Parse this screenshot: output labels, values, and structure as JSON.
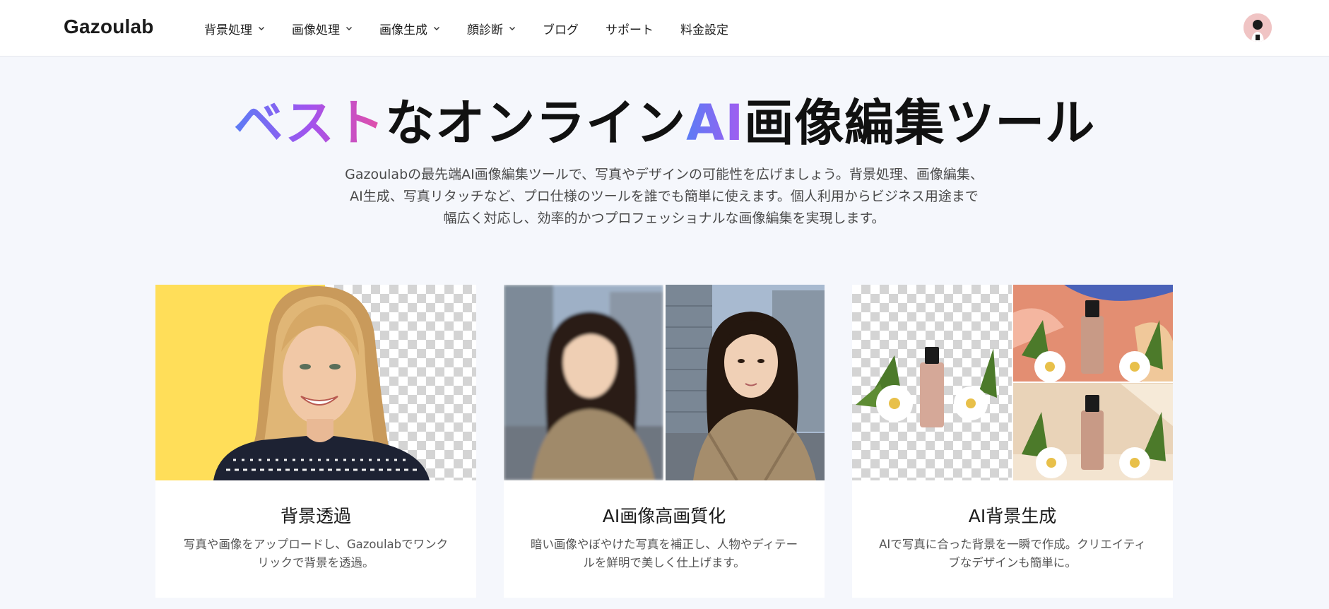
{
  "header": {
    "logo": "Gazoulab",
    "nav": [
      {
        "label": "背景処理",
        "dropdown": true
      },
      {
        "label": "画像処理",
        "dropdown": true
      },
      {
        "label": "画像生成",
        "dropdown": true
      },
      {
        "label": "顔診断",
        "dropdown": true
      },
      {
        "label": "ブログ",
        "dropdown": false
      },
      {
        "label": "サポート",
        "dropdown": false
      },
      {
        "label": "料金設定",
        "dropdown": false
      }
    ]
  },
  "hero": {
    "title_grad1": "ベスト",
    "title_mid": "なオンライン",
    "title_grad2": "AI",
    "title_end": "画像編集ツール",
    "desc_line1": "Gazoulabの最先端AI画像編集ツールで、写真やデザインの可能性を広げましょう。背景処理、画像編集、",
    "desc_line2": "AI生成、写真リタッチなど、プロ仕様のツールを誰でも簡単に使えます。個人利用からビジネス用途まで",
    "desc_line3": "幅広く対応し、効率的かつプロフェッショナルな画像編集を実現します。"
  },
  "cards": [
    {
      "title": "背景透過",
      "desc": "写真や画像をアップロードし、Gazoulabでワンクリックで背景を透過。"
    },
    {
      "title": "AI画像高画質化",
      "desc": "暗い画像やぼやけた写真を補正し、人物やディテールを鮮明で美しく仕上げます。"
    },
    {
      "title": "AI背景生成",
      "desc": "AIで写真に合った背景を一瞬で作成。クリエイティブなデザインも簡単に。"
    }
  ],
  "colors": {
    "gradient_start": "#5b7cf5",
    "gradient_mid": "#a253ee",
    "gradient_end": "#e54fa4",
    "page_bg": "#f5f7fc",
    "card_bg": "#ffffff",
    "demo_yellow": "#ffde59"
  }
}
